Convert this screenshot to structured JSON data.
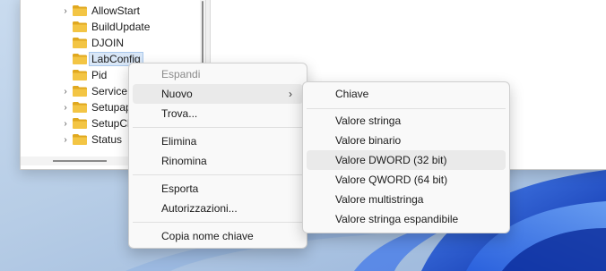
{
  "tree": {
    "items": [
      {
        "label": "AllowStart",
        "chevron": "›"
      },
      {
        "label": "BuildUpdate",
        "chevron": ""
      },
      {
        "label": "DJOIN",
        "chevron": ""
      },
      {
        "label": "LabConfig",
        "chevron": "",
        "selected": true
      },
      {
        "label": "Pid",
        "chevron": ""
      },
      {
        "label": "Service",
        "chevron": "›"
      },
      {
        "label": "Setupap",
        "chevron": "›"
      },
      {
        "label": "SetupCl",
        "chevron": "›"
      },
      {
        "label": "Status",
        "chevron": "›"
      }
    ]
  },
  "context_menu": {
    "expand": "Espandi",
    "new": "Nuovo",
    "find": "Trova...",
    "delete": "Elimina",
    "rename": "Rinomina",
    "export": "Esporta",
    "permissions": "Autorizzazioni...",
    "copy_key_name": "Copia nome chiave",
    "submenu_arrow": "›"
  },
  "new_submenu": {
    "key": "Chiave",
    "string_value": "Valore stringa",
    "binary_value": "Valore binario",
    "dword_value": "Valore DWORD (32 bit)",
    "qword_value": "Valore QWORD (64 bit)",
    "multistring_value": "Valore multistringa",
    "expandable_string_value": "Valore stringa espandibile"
  },
  "colors": {
    "folder": "#f3c544",
    "folder_dark": "#e0a81f",
    "menu_bg": "#f9f9f9",
    "hover": "#eaeaea",
    "wallpaper_blue": "#1f4fd1"
  }
}
